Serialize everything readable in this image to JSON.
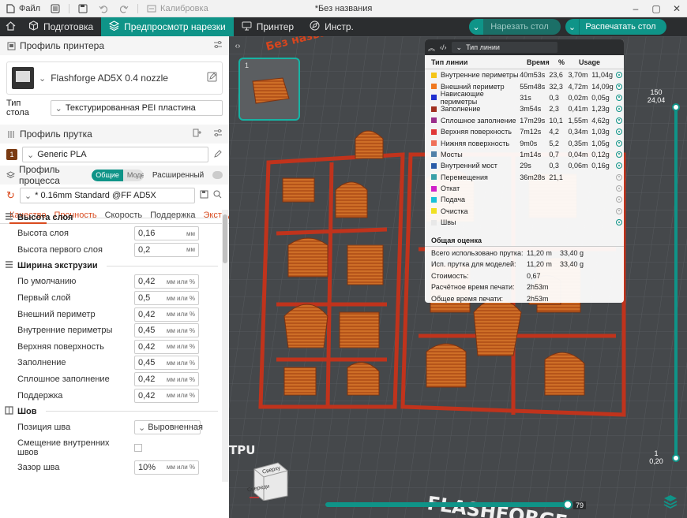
{
  "titlebar": {
    "file_label": "Файл",
    "calibration_label": "Калибровка",
    "window_title": "*Без названия"
  },
  "nav": {
    "prepare_label": "Подготовка",
    "preview_label": "Предпросмотр нарезки",
    "printer_label": "Принтер",
    "tools_label": "Инстр.",
    "slice_button": "Нарезать стол",
    "print_button": "Распечатать стол"
  },
  "printer": {
    "section_title": "Профиль принтера",
    "name": "Flashforge AD5X 0.4 nozzle",
    "bed_label": "Тип стола",
    "bed_value": "Текстурированная PEI пластина"
  },
  "filament": {
    "section_title": "Профиль прутка",
    "index": "1",
    "name": "Generic PLA"
  },
  "process": {
    "section_title": "Профиль процесса",
    "toggle_global": "Общие",
    "toggle_objects": "Модели",
    "advanced_label": "Расширенный",
    "preset": "* 0.16mm Standard @FF AD5X",
    "tabs": [
      "Качество",
      "Прочность",
      "Скорость",
      "Поддержка",
      "Экстру..."
    ]
  },
  "settings": {
    "layer_height": {
      "title": "Высота слоя",
      "rows": [
        {
          "label": "Высота слоя",
          "value": "0,16",
          "unit": "мм"
        },
        {
          "label": "Высота первого слоя",
          "value": "0,2",
          "unit": "мм"
        }
      ]
    },
    "line_width": {
      "title": "Ширина экструзии",
      "rows": [
        {
          "label": "По умолчанию",
          "value": "0,42",
          "unit": "мм или %"
        },
        {
          "label": "Первый слой",
          "value": "0,5",
          "unit": "мм или %"
        },
        {
          "label": "Внешний периметр",
          "value": "0,42",
          "unit": "мм или %"
        },
        {
          "label": "Внутренние периметры",
          "value": "0,45",
          "unit": "мм или %"
        },
        {
          "label": "Верхняя поверхность",
          "value": "0,42",
          "unit": "мм или %"
        },
        {
          "label": "Заполнение",
          "value": "0,45",
          "unit": "мм или %"
        },
        {
          "label": "Сплошное заполнение",
          "value": "0,42",
          "unit": "мм или %"
        },
        {
          "label": "Поддержка",
          "value": "0,42",
          "unit": "мм или %"
        }
      ]
    },
    "seam": {
      "title": "Шов",
      "position_label": "Позиция шва",
      "position_value": "Выровненная",
      "inner_label": "Смещение внутренних швов",
      "gap_label": "Зазор шва",
      "gap_value": "10%",
      "gap_unit": "мм или %"
    }
  },
  "legend": {
    "mode": "Тип линии",
    "headers": [
      "Тип линии",
      "Время",
      "%",
      "Usage"
    ],
    "rows": [
      {
        "name": "Внутренние периметры",
        "color": "#f5c518",
        "time": "40m53s",
        "pct": "23,6",
        "len": "3,70m",
        "weight": "11,04g",
        "visible": true
      },
      {
        "name": "Внешний периметр",
        "color": "#f07820",
        "time": "55m48s",
        "pct": "32,3",
        "len": "4,72m",
        "weight": "14,09g",
        "visible": true
      },
      {
        "name": "Нависающие периметры",
        "color": "#2030d0",
        "time": "31s",
        "pct": "0,3",
        "len": "0,02m",
        "weight": "0,05g",
        "visible": true
      },
      {
        "name": "Заполнение",
        "color": "#a03020",
        "time": "3m54s",
        "pct": "2,3",
        "len": "0,41m",
        "weight": "1,23g",
        "visible": true
      },
      {
        "name": "Сплошное заполнение",
        "color": "#9a2e8a",
        "time": "17m29s",
        "pct": "10,1",
        "len": "1,55m",
        "weight": "4,62g",
        "visible": true
      },
      {
        "name": "Верхняя поверхность",
        "color": "#e03838",
        "time": "7m12s",
        "pct": "4,2",
        "len": "0,34m",
        "weight": "1,03g",
        "visible": true
      },
      {
        "name": "Нижняя поверхность",
        "color": "#f07058",
        "time": "9m0s",
        "pct": "5,2",
        "len": "0,35m",
        "weight": "1,05g",
        "visible": true
      },
      {
        "name": "Мосты",
        "color": "#5080a8",
        "time": "1m14s",
        "pct": "0,7",
        "len": "0,04m",
        "weight": "0,12g",
        "visible": true
      },
      {
        "name": "Внутренний мост",
        "color": "#2a5ca8",
        "time": "29s",
        "pct": "0,3",
        "len": "0,06m",
        "weight": "0,16g",
        "visible": true
      },
      {
        "name": "Перемещения",
        "color": "#38a0a8",
        "time": "36m28s",
        "pct": "21,1",
        "len": "",
        "weight": "",
        "visible": false
      },
      {
        "name": "Откат",
        "color": "#d020c8",
        "time": "",
        "pct": "",
        "len": "",
        "weight": "",
        "visible": false
      },
      {
        "name": "Подача",
        "color": "#18c0d8",
        "time": "",
        "pct": "",
        "len": "",
        "weight": "",
        "visible": false
      },
      {
        "name": "Очистка",
        "color": "#f0e020",
        "time": "",
        "pct": "",
        "len": "",
        "weight": "",
        "visible": false
      },
      {
        "name": "Швы",
        "color": "#e8e8e8",
        "time": "",
        "pct": "",
        "len": "",
        "weight": "",
        "visible": true
      }
    ],
    "summary_title": "Общая оценка",
    "summary": [
      {
        "label": "Всего использовано прутка:",
        "v1": "11,20 m",
        "v2": "33,40 g"
      },
      {
        "label": "Исп. прутка для моделей:",
        "v1": "11,20 m",
        "v2": "33,40 g"
      },
      {
        "label": "Стоимость:",
        "v1": "0,67",
        "v2": ""
      },
      {
        "label": "Расчётное время печати:",
        "v1": "2h53m",
        "v2": ""
      },
      {
        "label": "Общее время печати:",
        "v1": "2h53m",
        "v2": ""
      }
    ]
  },
  "viewport": {
    "plate_number": "1",
    "layer_top_num": "150",
    "layer_top_height": "24,04",
    "layer_bottom_num": "1",
    "layer_bottom_height": "0,20",
    "move_value": "79",
    "cube_top": "Сверху",
    "cube_front": "Спереди",
    "bed_text_top": "Без названия",
    "bed_text_left": "TPU",
    "bed_text_bottom": "FLASHFORGE"
  },
  "colors": {
    "accent": "#0f9488",
    "bed": "#45484b",
    "model_orange": "#c8661a",
    "model_red": "#c0331c"
  }
}
